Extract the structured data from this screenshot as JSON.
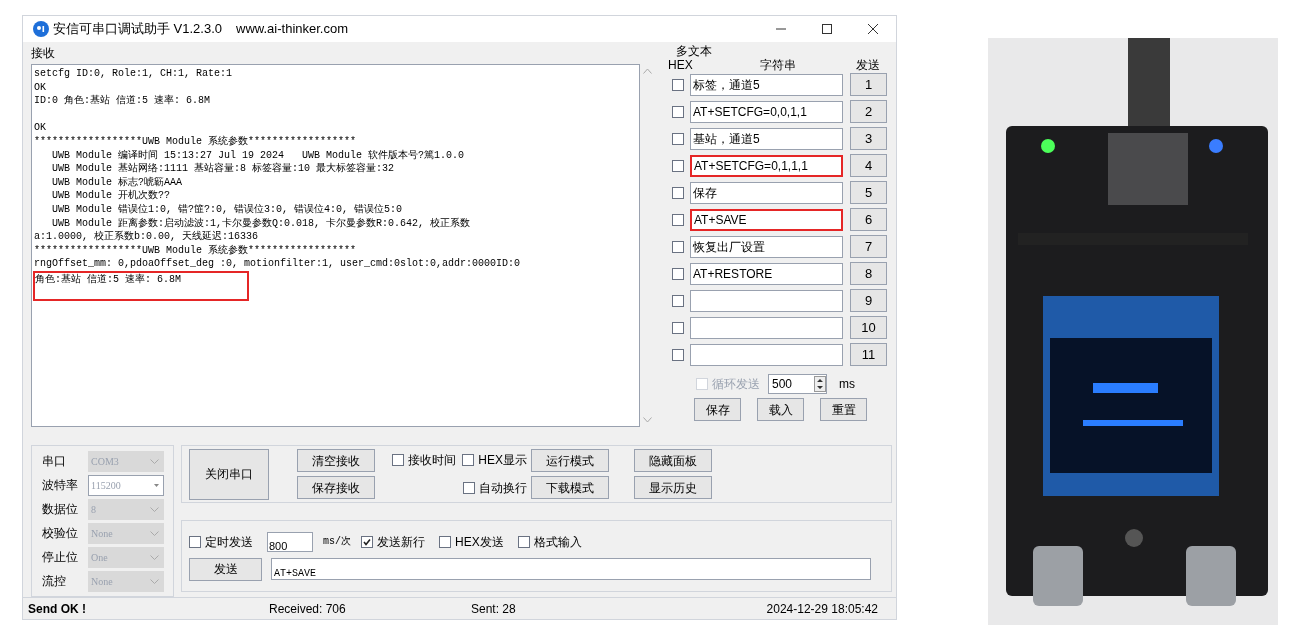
{
  "window": {
    "title": "安信可串口调试助手 V1.2.3.0",
    "url": "www.ai-thinker.com"
  },
  "receive": {
    "label": "接收",
    "lines": [
      {
        "kind": "text",
        "text": "setcfg ID:0, Role:1, CH:1, Rate:1",
        "highlighted": false
      },
      {
        "kind": "text",
        "text": "OK",
        "highlighted": false
      },
      {
        "kind": "text",
        "text": "ID:0 角色:基站 信道:5 速率: 6.8M",
        "highlighted": false
      },
      {
        "kind": "blank"
      },
      {
        "kind": "text",
        "text": "OK",
        "highlighted": false
      },
      {
        "kind": "text",
        "text": "******************UWB Module 系统参数******************",
        "highlighted": false
      },
      {
        "kind": "text",
        "text": "   UWB Module 编译时间 15:13:27 Jul 19 2024   UWB Module 软件版本号?篤1.0.0",
        "highlighted": false
      },
      {
        "kind": "text",
        "text": "   UWB Module 基站网络:1111 基站容量:8 标签容量:10 最大标签容量:32",
        "highlighted": false
      },
      {
        "kind": "text",
        "text": "   UWB Module 标志?唬簕AAA",
        "highlighted": false
      },
      {
        "kind": "text",
        "text": "   UWB Module 开机次数??",
        "highlighted": false
      },
      {
        "kind": "text",
        "text": "   UWB Module 错误位1:0, 错?篚?:0, 错误位3:0, 错误位4:0, 错误位5:0",
        "highlighted": false
      },
      {
        "kind": "text",
        "text": "   UWB Module 距离参数:启动滤波:1,卡尔曼参数Q:0.018, 卡尔曼参数R:0.642, 校正系数",
        "highlighted": false
      },
      {
        "kind": "text",
        "text": "a:1.0000, 校正系数b:0.00, 天线延迟:16336",
        "highlighted": false
      },
      {
        "kind": "text",
        "text": "******************UWB Module 系统参数******************",
        "highlighted": false
      },
      {
        "kind": "text",
        "text": "rngOffset_mm: 0,pdoaOffset_deg :0, motionfilter:1, user_cmd:0slot:0,addr:0000ID:0",
        "highlighted": false
      },
      {
        "kind": "text",
        "text": "角色:基站 信道:5 速率: 6.8M",
        "highlighted": true
      }
    ]
  },
  "multi_text": {
    "label": "多文本",
    "columns": [
      "HEX",
      "字符串",
      "发送"
    ],
    "rows": [
      {
        "hex": false,
        "text": "标签，通道5",
        "button": "1",
        "highlighted": false
      },
      {
        "hex": false,
        "text": "AT+SETCFG=0,0,1,1",
        "button": "2",
        "highlighted": false
      },
      {
        "hex": false,
        "text": "基站，通道5",
        "button": "3",
        "highlighted": false
      },
      {
        "hex": false,
        "text": "AT+SETCFG=0,1,1,1",
        "button": "4",
        "highlighted": true
      },
      {
        "hex": false,
        "text": "保存",
        "button": "5",
        "highlighted": false
      },
      {
        "hex": false,
        "text": "AT+SAVE",
        "button": "6",
        "highlighted": true
      },
      {
        "hex": false,
        "text": "恢复出厂设置",
        "button": "7",
        "highlighted": false
      },
      {
        "hex": false,
        "text": "AT+RESTORE",
        "button": "8",
        "highlighted": false
      },
      {
        "hex": false,
        "button": "9",
        "highlighted": false
      },
      {
        "hex": false,
        "button": "10",
        "highlighted": false
      },
      {
        "hex": false,
        "button": "11",
        "highlighted": false
      }
    ],
    "loop_send": {
      "label": "循环发送",
      "checked": false,
      "disabled": true,
      "value": "500",
      "unit": "ms"
    },
    "buttons": [
      "保存",
      "载入",
      "重置"
    ]
  },
  "port_settings": [
    {
      "label": "串口",
      "value": "COM3",
      "disabled": true
    },
    {
      "label": "波特率",
      "value": "115200",
      "disabled": false
    },
    {
      "label": "数据位",
      "value": "8",
      "disabled": true
    },
    {
      "label": "校验位",
      "value": "None",
      "disabled": true
    },
    {
      "label": "停止位",
      "value": "One",
      "disabled": true
    },
    {
      "label": "流控",
      "value": "None",
      "disabled": true
    }
  ],
  "controls": {
    "port_button": "关闭串口",
    "receive_buttons": [
      "清空接收",
      "保存接收"
    ],
    "receive_time": {
      "label": "接收时间",
      "checked": false
    },
    "hex_display": {
      "label": "HEX显示",
      "checked": false
    },
    "auto_wrap": {
      "label": "自动换行",
      "checked": false
    },
    "mode_buttons": [
      "运行模式",
      "下载模式"
    ],
    "panel_buttons": [
      "隐藏面板",
      "显示历史"
    ]
  },
  "send": {
    "timed": {
      "label": "定时发送",
      "checked": false
    },
    "interval": "800",
    "interval_unit": "ms/次",
    "options": [
      {
        "label": "发送新行",
        "checked": true
      },
      {
        "label": "HEX发送",
        "checked": false
      },
      {
        "label": "格式输入",
        "checked": false
      }
    ],
    "button": "发送",
    "input": "AT+SAVE"
  },
  "status_bar": {
    "message": "Send OK !",
    "received": "Received: 706",
    "sent": "Sent: 28",
    "time": "2024-12-29 18:05:42"
  }
}
